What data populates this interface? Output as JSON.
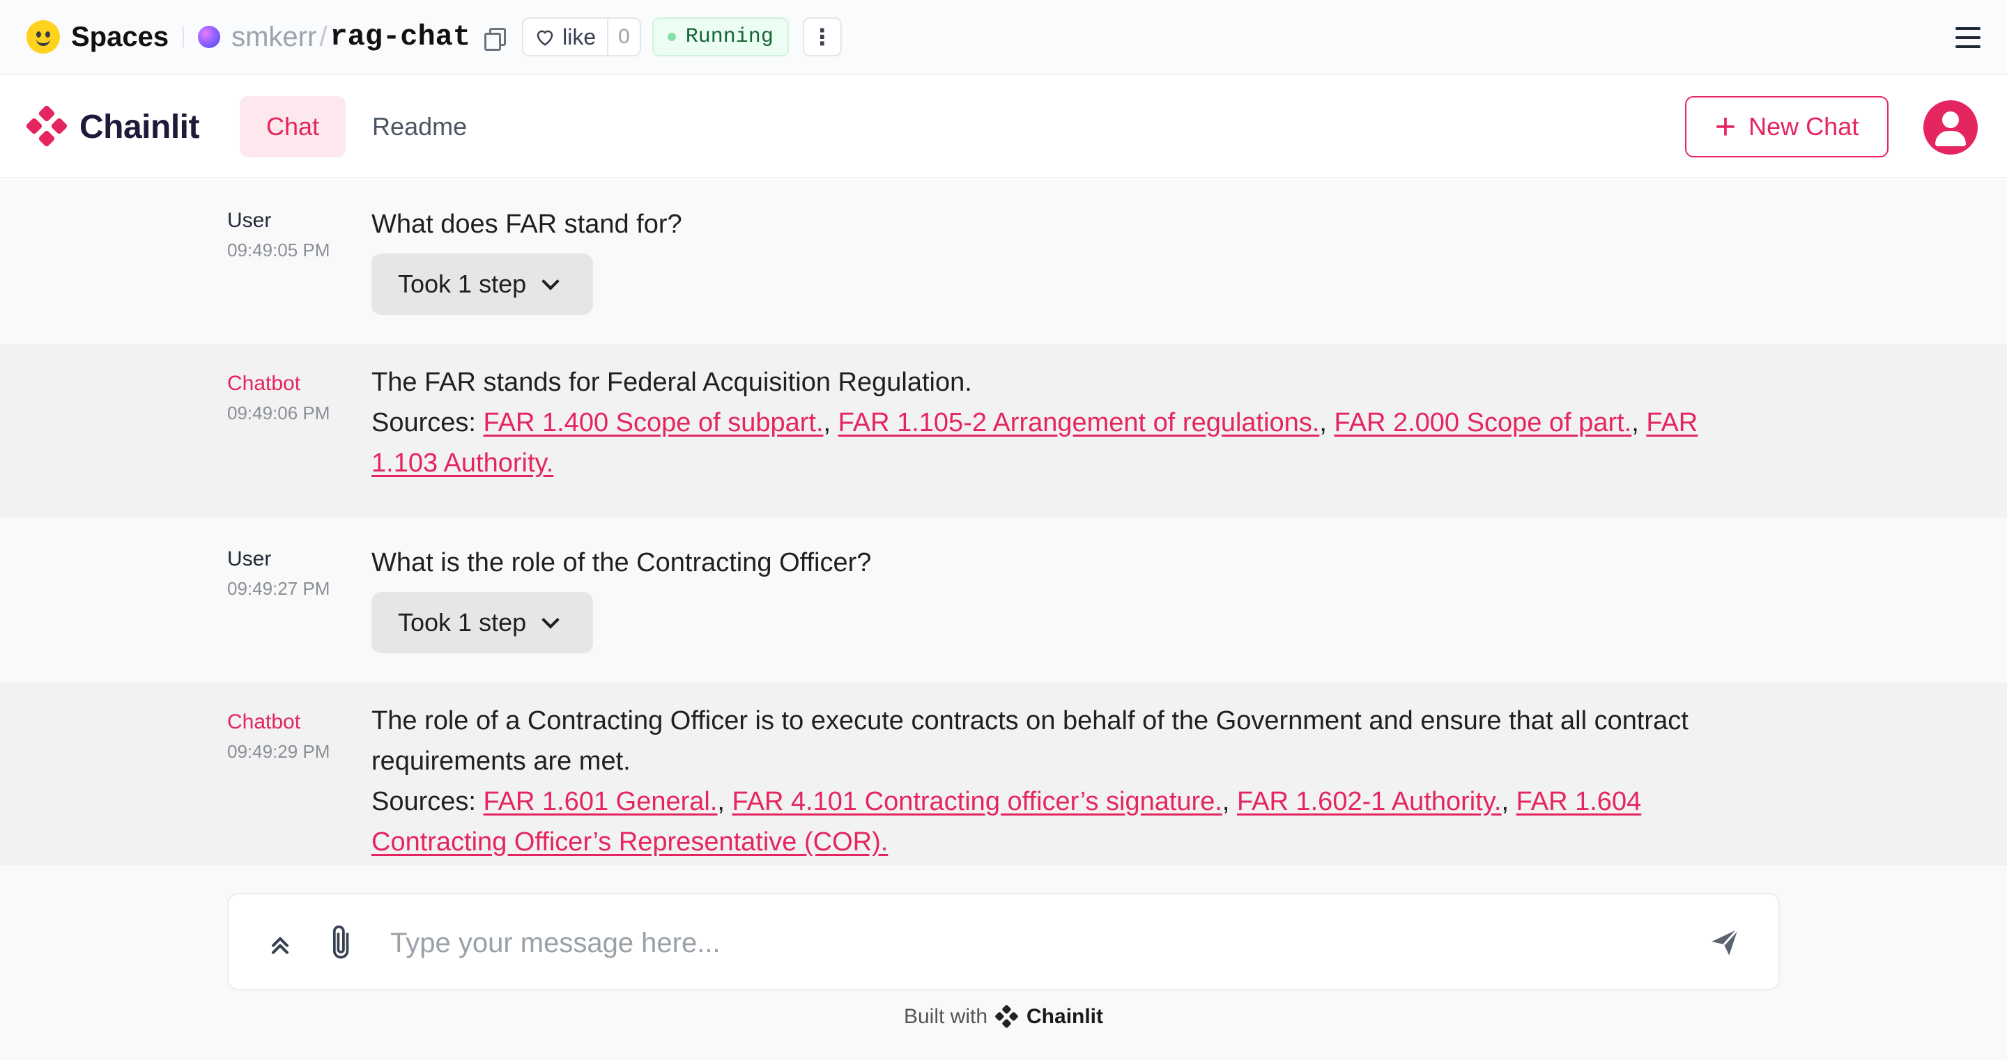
{
  "hf": {
    "spaces_label": "Spaces",
    "owner": "smkerr",
    "slash": "/",
    "repo": "rag-chat",
    "like_label": "like",
    "like_count": "0",
    "status": "Running",
    "kebab": "⋮"
  },
  "header": {
    "brand": "Chainlit",
    "tabs": [
      {
        "label": "Chat",
        "active": true
      },
      {
        "label": "Readme",
        "active": false
      }
    ],
    "new_chat_label": "New Chat",
    "accent_color": "#e5255f"
  },
  "messages": [
    {
      "author": "User",
      "time": "09:49:05 PM",
      "text": "What does FAR stand for?",
      "step_label": "Took 1 step"
    },
    {
      "author": "Chatbot",
      "time": "09:49:06 PM",
      "text": "The FAR stands for Federal Acquisition Regulation.",
      "sources_label": "Sources:",
      "sources": [
        "FAR 1.400 Scope of subpart.",
        "FAR 1.105-2 Arrangement of regulations.",
        "FAR 2.000 Scope of part.",
        "FAR 1.103 Authority."
      ]
    },
    {
      "author": "User",
      "time": "09:49:27 PM",
      "text": "What is the role of the Contracting Officer?",
      "step_label": "Took 1 step"
    },
    {
      "author": "Chatbot",
      "time": "09:49:29 PM",
      "text": "The role of a Contracting Officer is to execute contracts on behalf of the Government and ensure that all contract requirements are met.",
      "sources_label": "Sources:",
      "sources": [
        "FAR 1.601 General.",
        "FAR 4.101 Contracting officer’s signature.",
        "FAR 1.602-1 Authority.",
        "FAR 1.604 Contracting Officer’s Representative (COR)."
      ]
    }
  ],
  "composer": {
    "placeholder": "Type your message here..."
  },
  "footer": {
    "built_with": "Built with",
    "brand": "Chainlit"
  }
}
